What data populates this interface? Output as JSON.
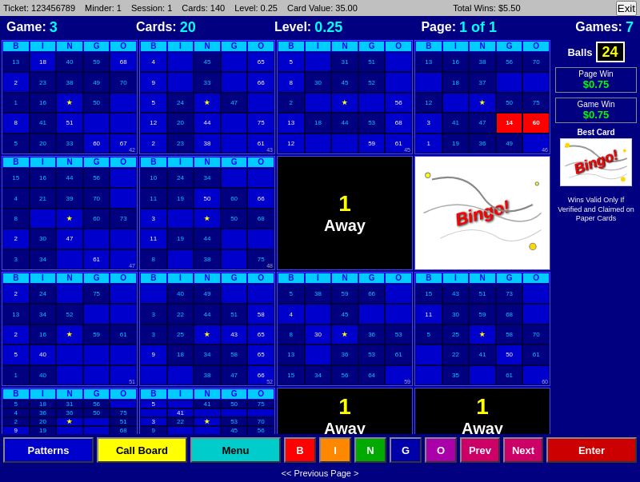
{
  "topBar": {
    "ticket": "Ticket: 123456789",
    "minder": "Minder: 1",
    "session": "Session: 1",
    "cards": "Cards: 140",
    "level": "Level: 0.25",
    "cardValue": "Card Value: 35.00",
    "totalWins": "Total Wins: $5.50",
    "exitLabel": "Exit"
  },
  "gameBar": {
    "gameLabel": "Game:",
    "gameVal": "3",
    "cardsLabel": "Cards:",
    "cardsVal": "20",
    "levelLabel": "Level:",
    "levelVal": "0.25",
    "pageLabel": "Page:",
    "pageVal": "1 of 1",
    "gamesLabel": "Games:",
    "gamesVal": "7"
  },
  "rightPanel": {
    "ballsLabel": "Balls",
    "ballsCount": "24",
    "pageWinLabel": "Page Win",
    "pageWinVal": "$0.75",
    "gameWinLabel": "Game Win",
    "gameWinVal": "$0.75",
    "bestCardLabel": "Best Card",
    "bingoText": "Bingo",
    "winsValid": "Wins Valid Only If Verified and Claimed on Paper Cards"
  },
  "toolbar": {
    "patterns": "Patterns",
    "callBoard": "Call Board",
    "menu": "Menu",
    "b": "B",
    "i": "I",
    "n": "N",
    "g": "G",
    "o": "O",
    "prev": "Prev",
    "next": "Next",
    "enter": "Enter"
  },
  "prevPage": "<< Previous Page >",
  "away": "Away",
  "num1": "1"
}
